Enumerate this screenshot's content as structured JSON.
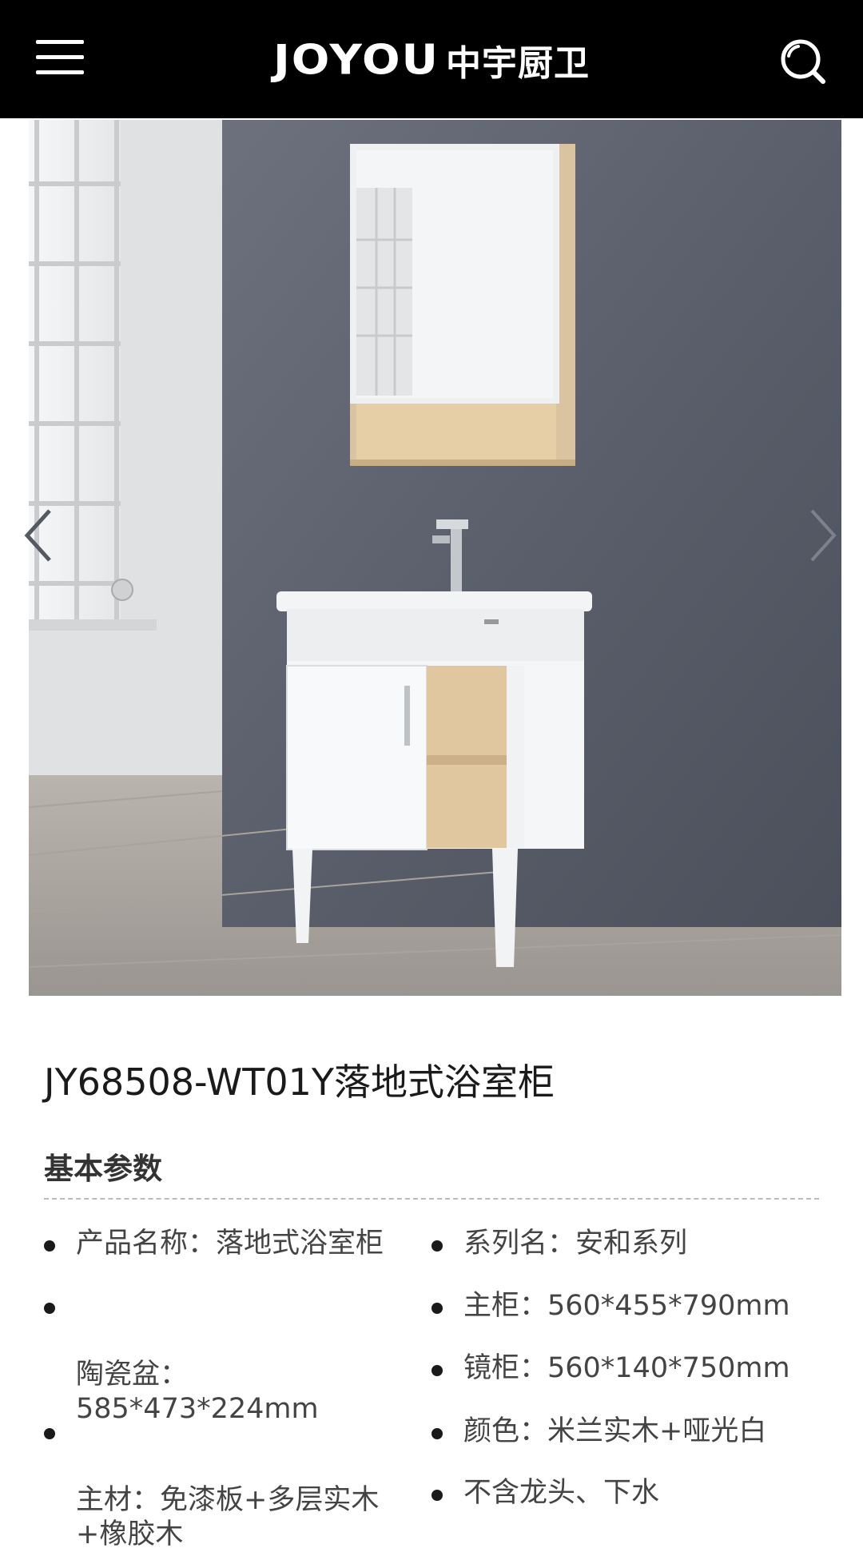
{
  "header": {
    "brand": "JOYOU",
    "brand_cn": "中宇厨卫",
    "menu_icon": "hamburger-menu-icon",
    "search_icon": "search-icon",
    "background_color": "#000000"
  },
  "gallery": {
    "prev_icon": "chevron-left-icon",
    "next_icon": "chevron-right-icon"
  },
  "product": {
    "title": "JY68508-WT01Y落地式浴室柜"
  },
  "specs": {
    "section_title": "基本参数",
    "left": [
      "产品名称：落地式浴室柜",
      "陶瓷盆：\n585*473*224mm",
      "主材：免漆板+多层实木\n+橡胶木"
    ],
    "right": [
      "系列名：安和系列",
      "主柜：560*455*790mm",
      "镜柜：560*140*750mm",
      "颜色：米兰实木+哑光白",
      "不含龙头、下水"
    ]
  }
}
